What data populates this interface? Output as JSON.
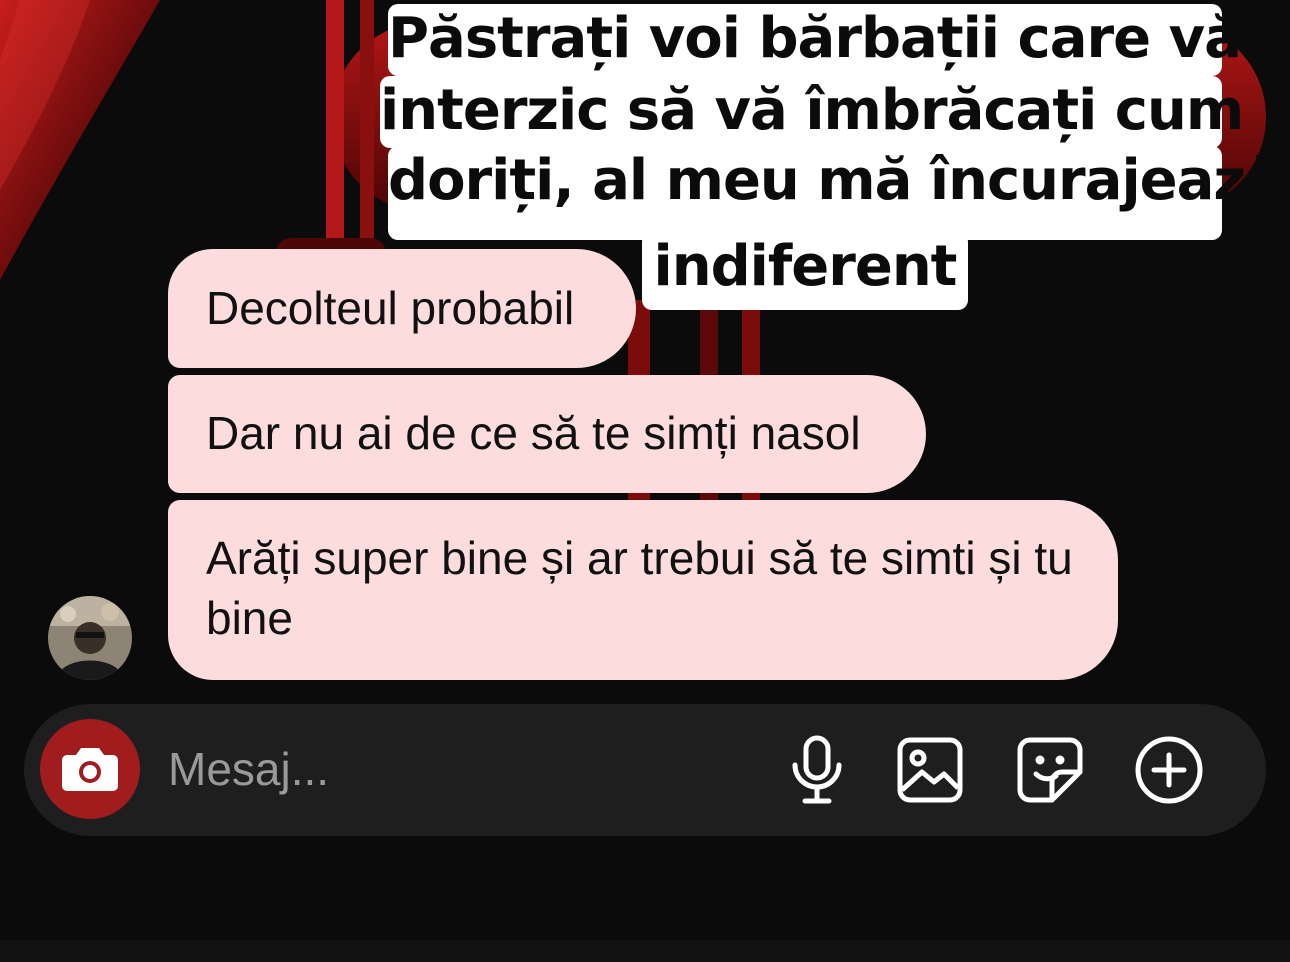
{
  "caption": {
    "lines": [
      "Păstrați voi bărbații care vă",
      "interzic să vă îmbrăcați cum",
      "doriți, al meu mă încurajează",
      "indiferent"
    ]
  },
  "messages": [
    {
      "text": "Decolteul probabil"
    },
    {
      "text": "Dar nu ai de ce să te simți nasol"
    },
    {
      "text": "Arăți super bine și ar trebui să te simti și tu bine"
    }
  ],
  "composer": {
    "placeholder": "Mesaj...",
    "camera_icon": "camera-icon",
    "tools": [
      "microphone-icon",
      "gallery-icon",
      "sticker-icon",
      "plus-circle-icon"
    ]
  },
  "colors": {
    "background": "#0b0b0b",
    "bubble": "#fcdcdd",
    "camera_button": "#a11c1c",
    "composer": "#1e1e1e"
  }
}
